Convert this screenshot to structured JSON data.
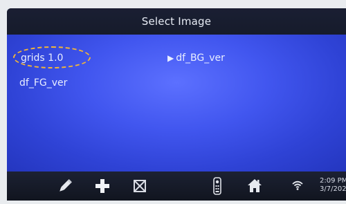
{
  "header": {
    "title": "Select Image"
  },
  "files": {
    "grids": "grids 1.0",
    "fg": "df_FG_ver",
    "bg": "df_BG_ver",
    "selected_marker": "▶"
  },
  "toolbar": {
    "icons": [
      "pencil-icon",
      "plus-icon",
      "delete-box-icon",
      "remote-icon",
      "home-icon"
    ]
  },
  "status": {
    "time": "2:09 PM",
    "date": "3/7/202",
    "wifi_icon": "wifi-icon"
  },
  "colors": {
    "highlight": "#f3b638",
    "content_bg": "#4156ef",
    "bar_bg": "#161b2b",
    "text": "#e9eeff"
  }
}
